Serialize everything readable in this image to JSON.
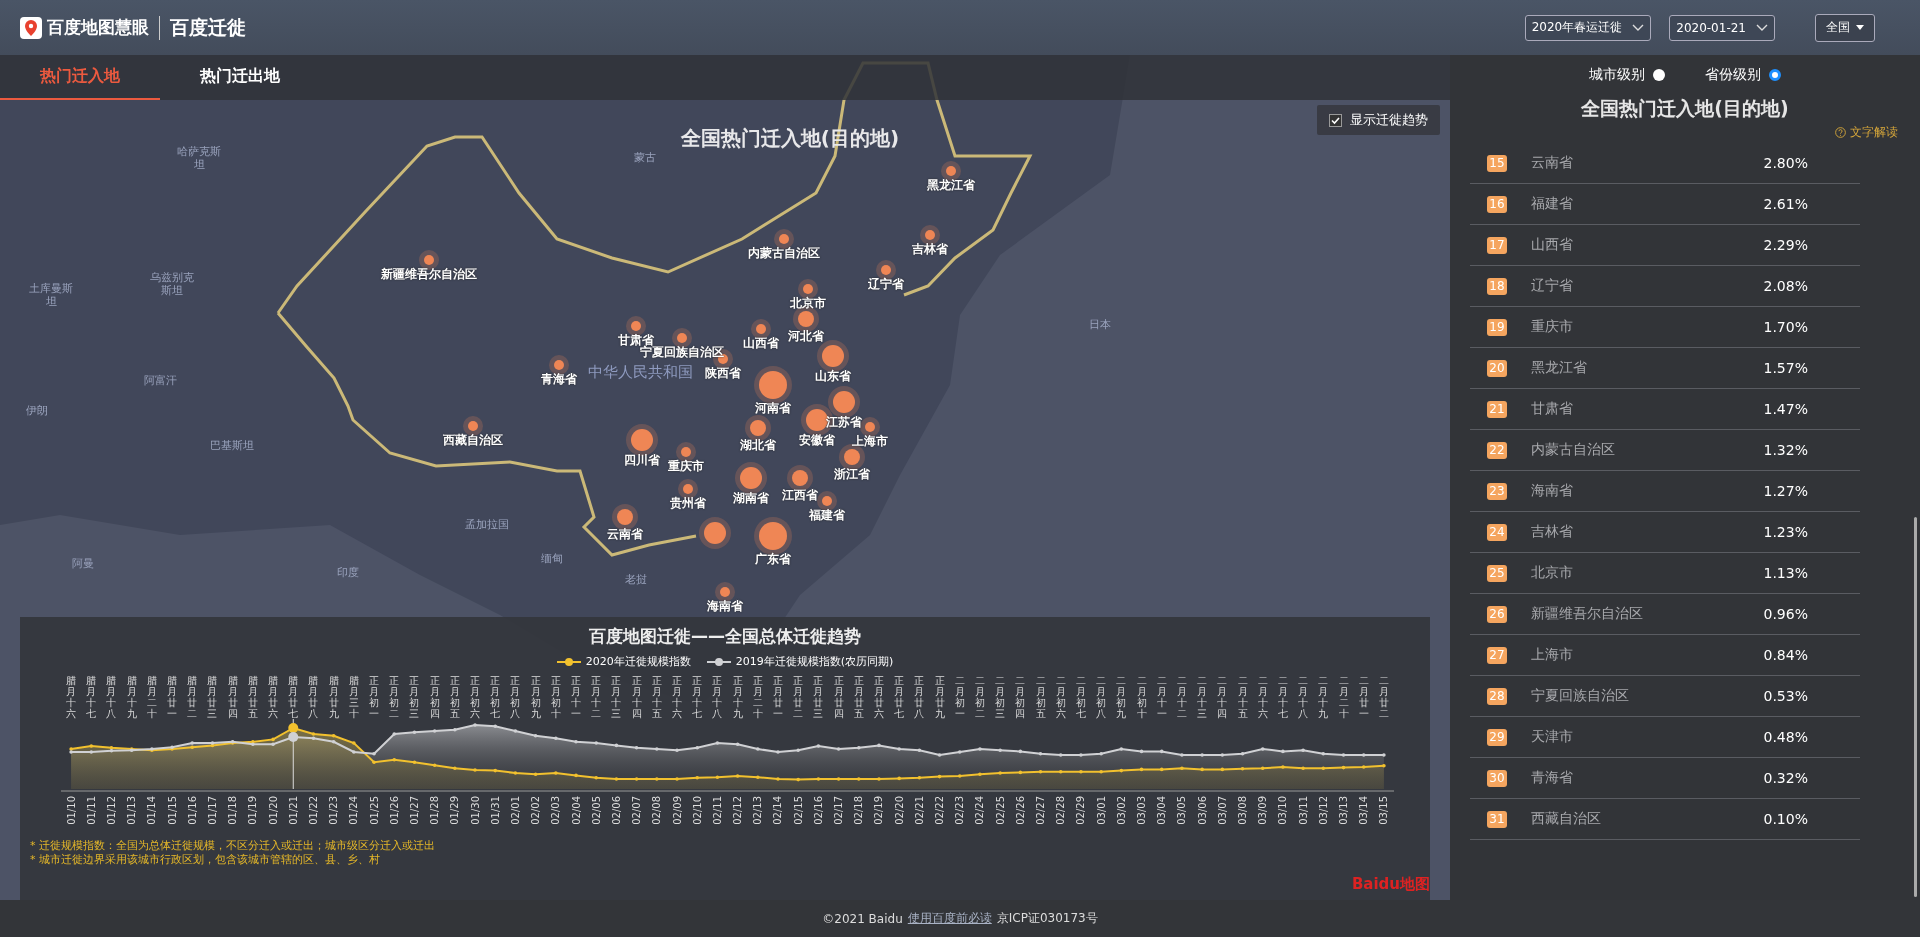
{
  "header": {
    "logo": "百度地图慧眼",
    "product": "百度迁徙",
    "season_select": "2020年春运迁徙",
    "date_select": "2020-01-21",
    "region_button": "全国"
  },
  "tabs": [
    {
      "label": "热门迁入地",
      "selected": true
    },
    {
      "label": "热门迁出地",
      "selected": false
    }
  ],
  "map": {
    "title": "全国热门迁入地(目的地)",
    "trend_toggle": {
      "label": "显示迁徙趋势",
      "checked": true
    },
    "countries": [
      "哈萨克斯坦",
      "蒙古",
      "乌兹别克斯坦",
      "土库曼斯坦",
      "阿富汗",
      "伊朗",
      "巴基斯坦",
      "中华人民共和国",
      "孟加拉国",
      "缅甸",
      "印度",
      "老挝",
      "阿曼",
      "日本"
    ],
    "places": [
      {
        "name": "黑龙江省",
        "kind": "small"
      },
      {
        "name": "内蒙古自治区",
        "kind": "small"
      },
      {
        "name": "吉林省",
        "kind": "small"
      },
      {
        "name": "新疆维吾尔自治区",
        "kind": "small"
      },
      {
        "name": "辽宁省",
        "kind": "small"
      },
      {
        "name": "北京市",
        "kind": "small"
      },
      {
        "name": "甘肃省",
        "kind": "small"
      },
      {
        "name": "宁夏回族自治区",
        "kind": "small"
      },
      {
        "name": "山西省",
        "kind": "small"
      },
      {
        "name": "河北省",
        "kind": "medium"
      },
      {
        "name": "青海省",
        "kind": "small"
      },
      {
        "name": "陕西省",
        "kind": "small"
      },
      {
        "name": "山东省",
        "kind": "large"
      },
      {
        "name": "河南省",
        "kind": "largest"
      },
      {
        "name": "江苏省",
        "kind": "large"
      },
      {
        "name": "西藏自治区",
        "kind": "small"
      },
      {
        "name": "湖北省",
        "kind": "medium"
      },
      {
        "name": "安徽省",
        "kind": "large"
      },
      {
        "name": "上海市",
        "kind": "small"
      },
      {
        "name": "四川省",
        "kind": "large"
      },
      {
        "name": "重庆市",
        "kind": "small"
      },
      {
        "name": "浙江省",
        "kind": "medium"
      },
      {
        "name": "贵州省",
        "kind": "small"
      },
      {
        "name": "湖南省",
        "kind": "large"
      },
      {
        "name": "江西省",
        "kind": "medium"
      },
      {
        "name": "福建省",
        "kind": "small"
      },
      {
        "name": "云南省",
        "kind": "medium"
      },
      {
        "kind": "large"
      },
      {
        "name": "广东省",
        "kind": "largest"
      },
      {
        "name": "海南省",
        "kind": "small"
      }
    ]
  },
  "levels": [
    {
      "label": "城市级别",
      "selected": false
    },
    {
      "label": "省份级别",
      "selected": true
    }
  ],
  "ranking": {
    "title": "全国热门迁入地(目的地)",
    "help_link": "文字解读",
    "rows": [
      {
        "rank": "15",
        "name": "云南省",
        "share": "2.80%"
      },
      {
        "rank": "16",
        "name": "福建省",
        "share": "2.61%"
      },
      {
        "rank": "17",
        "name": "山西省",
        "share": "2.29%"
      },
      {
        "rank": "18",
        "name": "辽宁省",
        "share": "2.08%"
      },
      {
        "rank": "19",
        "name": "重庆市",
        "share": "1.70%"
      },
      {
        "rank": "20",
        "name": "黑龙江省",
        "share": "1.57%"
      },
      {
        "rank": "21",
        "name": "甘肃省",
        "share": "1.47%"
      },
      {
        "rank": "22",
        "name": "内蒙古自治区",
        "share": "1.32%"
      },
      {
        "rank": "23",
        "name": "海南省",
        "share": "1.27%"
      },
      {
        "rank": "24",
        "name": "吉林省",
        "share": "1.23%"
      },
      {
        "rank": "25",
        "name": "北京市",
        "share": "1.13%"
      },
      {
        "rank": "26",
        "name": "新疆维吾尔自治区",
        "share": "0.96%"
      },
      {
        "rank": "27",
        "name": "上海市",
        "share": "0.84%"
      },
      {
        "rank": "28",
        "name": "宁夏回族自治区",
        "share": "0.53%"
      },
      {
        "rank": "29",
        "name": "天津市",
        "share": "0.48%"
      },
      {
        "rank": "30",
        "name": "青海省",
        "share": "0.32%"
      },
      {
        "rank": "31",
        "name": "西藏自治区",
        "share": "0.10%"
      }
    ]
  },
  "trend_chart": {
    "title": "百度地图迁徙——全国总体迁徙趋势",
    "series": [
      {
        "name": "2020年迁徙规模指数",
        "color": "#f2c12e"
      },
      {
        "name": "2019年迁徙规模指数(农历同期)",
        "color": "#d0d1d4"
      }
    ],
    "lunar_labels": [
      "腊月十六",
      "腊月十七",
      "腊月十八",
      "腊月十九",
      "腊月二十",
      "腊月廿一",
      "腊月廿二",
      "腊月廿三",
      "腊月廿四",
      "腊月廿五",
      "腊月廿六",
      "腊月廿七",
      "腊月廿八",
      "腊月廿九",
      "腊月三十",
      "正月初一",
      "正月初二",
      "正月初三",
      "正月初四",
      "正月初五",
      "正月初六",
      "正月初七",
      "正月初八",
      "正月初九",
      "正月初十",
      "正月十一",
      "正月十二",
      "正月十三",
      "正月十四",
      "正月十五",
      "正月十六",
      "正月十七",
      "正月十八",
      "正月十九",
      "正月二十",
      "正月廿一",
      "正月廿二",
      "正月廿三",
      "正月廿四",
      "正月廿五",
      "正月廿六",
      "正月廿七",
      "正月廿八",
      "正月廿九",
      "二月初一",
      "二月初二",
      "二月初三",
      "二月初四",
      "二月初五",
      "二月初六",
      "二月初七",
      "二月初八",
      "二月初九",
      "二月初十",
      "二月十一",
      "二月十二",
      "二月十三",
      "二月十四",
      "二月十五",
      "二月十六",
      "二月十七",
      "二月十八",
      "二月十九",
      "二月二十",
      "二月廿一",
      "二月廿二"
    ],
    "dates": [
      "01/10",
      "01/11",
      "01/12",
      "01/13",
      "01/14",
      "01/15",
      "01/16",
      "01/17",
      "01/18",
      "01/19",
      "01/20",
      "01/21",
      "01/22",
      "01/23",
      "01/24",
      "01/25",
      "01/26",
      "01/27",
      "01/28",
      "01/29",
      "01/30",
      "01/31",
      "02/01",
      "02/02",
      "02/03",
      "02/04",
      "02/05",
      "02/06",
      "02/07",
      "02/08",
      "02/09",
      "02/10",
      "02/11",
      "02/12",
      "02/13",
      "02/14",
      "02/15",
      "02/16",
      "02/17",
      "02/18",
      "02/19",
      "02/20",
      "02/21",
      "02/22",
      "02/23",
      "02/24",
      "02/25",
      "02/26",
      "02/27",
      "02/28",
      "02/29",
      "03/01",
      "03/02",
      "03/03",
      "03/04",
      "03/05",
      "03/06",
      "03/07",
      "03/08",
      "03/09",
      "03/10",
      "03/11",
      "03/12",
      "03/13",
      "03/14",
      "03/15"
    ],
    "notes": [
      "* 迁徙规模指数：全国为总体迁徙规模，不区分迁入或迁出；城市级区分迁入或迁出",
      "* 城市迁徙边界采用该城市行政区划，包含该城市管辖的区、县、乡、村"
    ]
  },
  "map_logo": "Baidu地图",
  "footer": {
    "copyright": "©2021 Baidu",
    "link": "使用百度前必读",
    "icp": "京ICP证030173号"
  }
}
